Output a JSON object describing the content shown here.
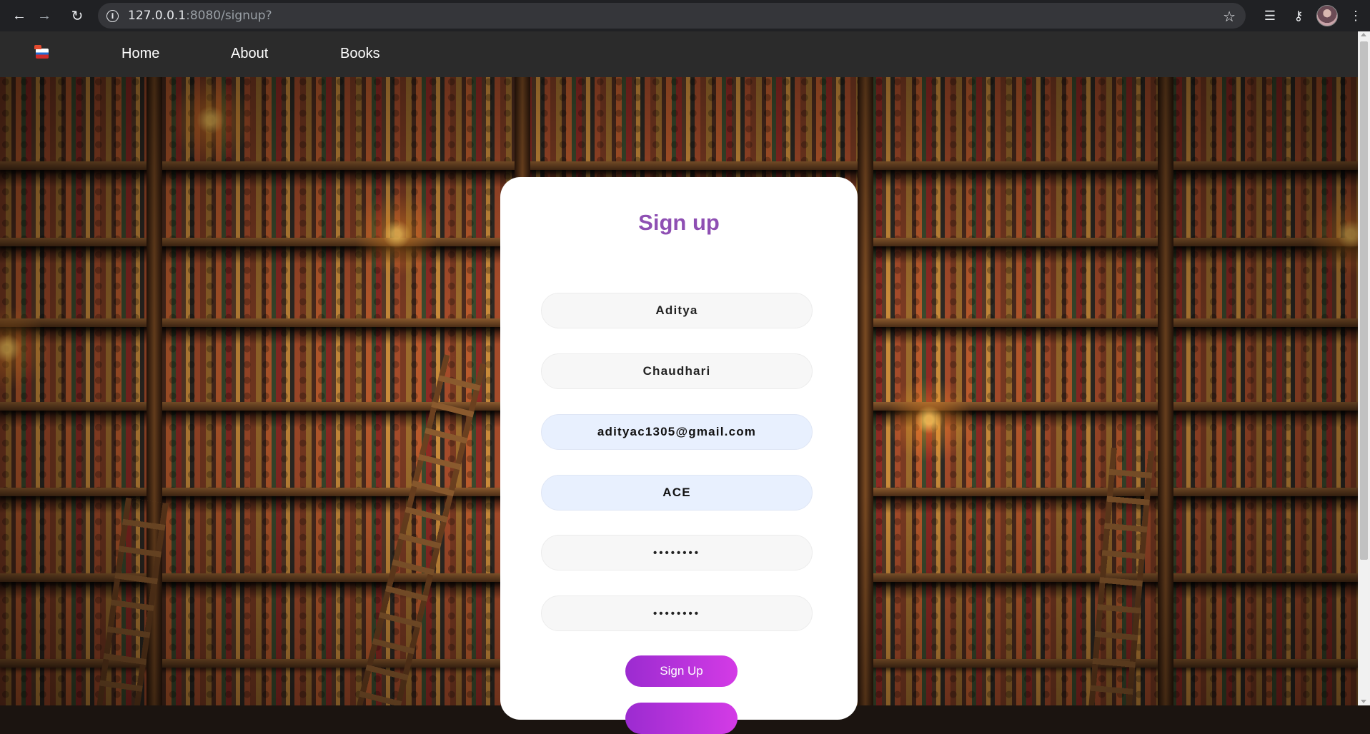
{
  "browser": {
    "url_host": "127.0.0.1",
    "url_rest": ":8080/signup?",
    "icons": [
      "back-arrow-icon",
      "forward-arrow-icon",
      "reload-icon",
      "info-icon",
      "star-icon",
      "media-queue-icon",
      "key-icon",
      "profile-avatar",
      "menu-dots-icon"
    ]
  },
  "nav": {
    "logo": "flag-logo-icon",
    "links": [
      {
        "label": "Home"
      },
      {
        "label": "About"
      },
      {
        "label": "Books"
      }
    ]
  },
  "signup": {
    "title": "Sign up",
    "fields": {
      "first_name": "Aditya",
      "last_name": "Chaudhari",
      "email": "adityac1305@gmail.com",
      "username": "ACE",
      "password": "••••••••",
      "confirm_password": "••••••••"
    },
    "submit_label": "Sign Up"
  },
  "colors": {
    "title": "#8e4fb3",
    "button_start": "#9b2bd0",
    "button_end": "#d43be6",
    "nav_bg": "#2b2b2b"
  }
}
